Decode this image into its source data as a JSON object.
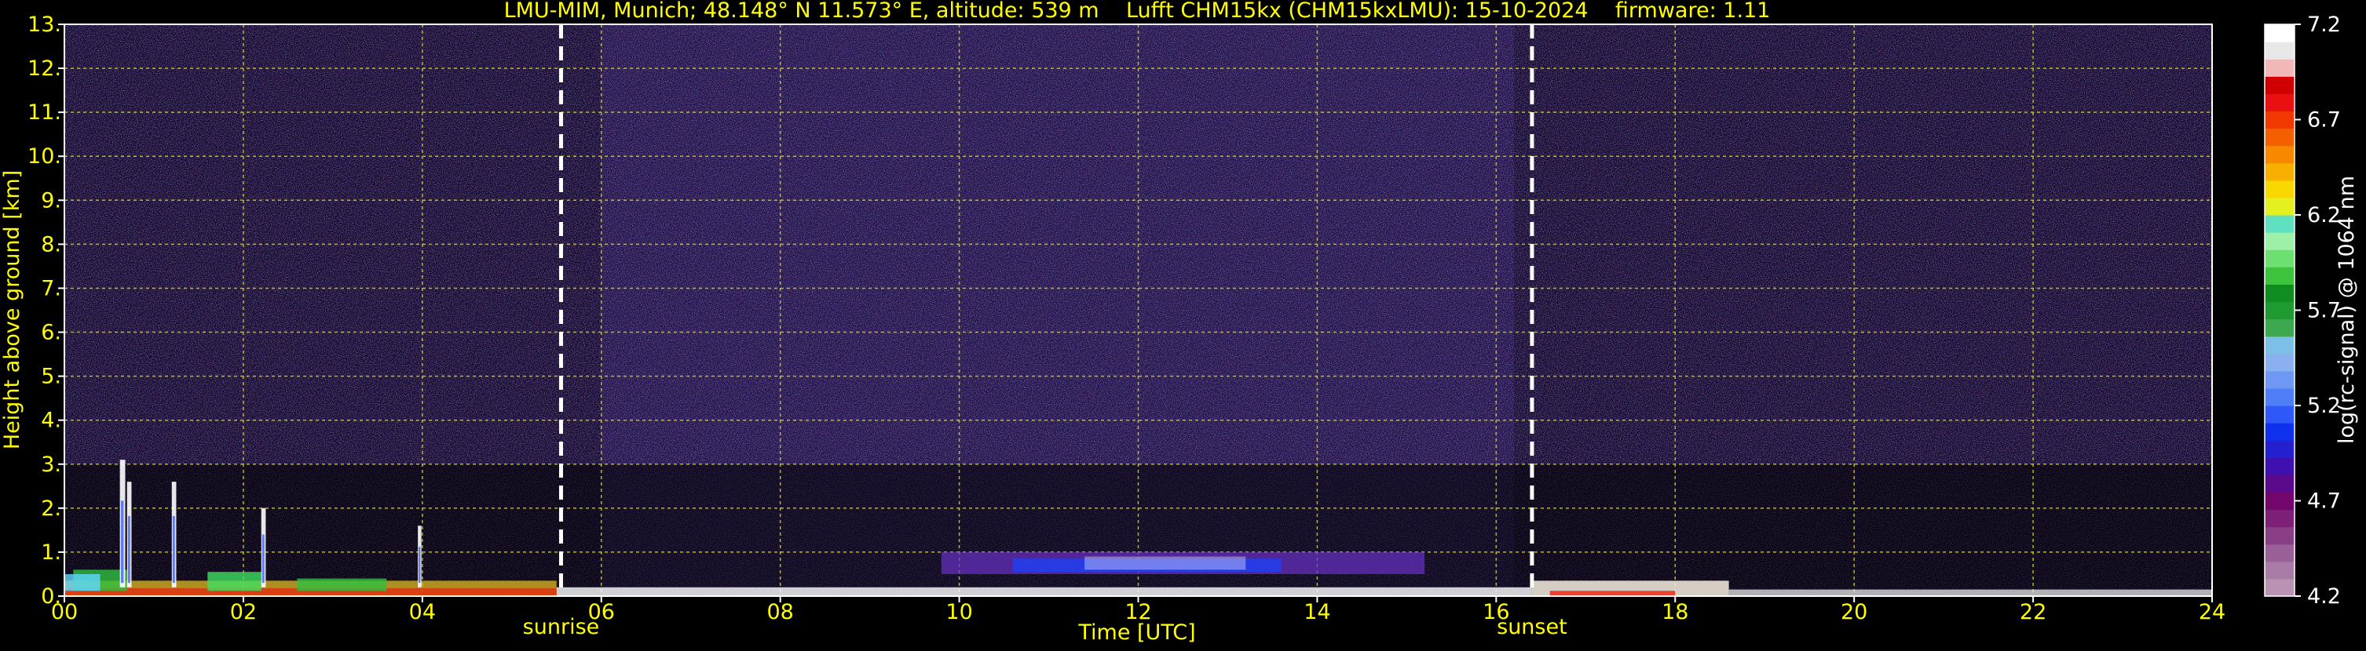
{
  "chart_data": {
    "type": "heatmap",
    "title": "LMU-MIM, Munich; 48.148° N 11.573° E, altitude: 539 m    Lufft CHM15kx (CHM15kxLMU): 15-10-2024    firmware: 1.11",
    "xlabel": "Time [UTC]",
    "ylabel": "Height above ground [km]",
    "xlim": [
      0,
      24
    ],
    "ylim": [
      0,
      13
    ],
    "x_ticks": [
      "00",
      "02",
      "04",
      "06",
      "08",
      "10",
      "12",
      "14",
      "16",
      "18",
      "20",
      "22",
      "24"
    ],
    "y_ticks": [
      "0.",
      "1.",
      "2.",
      "3.",
      "4.",
      "5.",
      "6.",
      "7.",
      "8.",
      "9.",
      "10.",
      "11.",
      "12.",
      "13."
    ],
    "grid": true,
    "colorbar": {
      "label": "log(rc-signal) @ 1064 nm",
      "range": [
        4.2,
        7.2
      ],
      "ticks": [
        "4.2",
        "4.7",
        "5.2",
        "5.7",
        "6.2",
        "6.7",
        "7.2"
      ],
      "colors": [
        "#b894b2",
        "#a87ca6",
        "#9a6098",
        "#8a3e86",
        "#7e1f78",
        "#72066c",
        "#5a0a8a",
        "#3e10b0",
        "#2420d0",
        "#1030f0",
        "#2e58f8",
        "#4f7ef8",
        "#6e98f4",
        "#8ab0f0",
        "#7cc0e8",
        "#3ea850",
        "#1e9a30",
        "#108c20",
        "#3cc43c",
        "#6ce070",
        "#9cf0a8",
        "#60e0c0",
        "#e4f020",
        "#f8d800",
        "#f8b000",
        "#f88800",
        "#f46000",
        "#f03800",
        "#e81010",
        "#d00000",
        "#f0b8b8",
        "#e8e8e8",
        "#ffffff"
      ]
    },
    "events": [
      {
        "label": "sunrise",
        "time": 5.55
      },
      {
        "label": "sunset",
        "time": 16.4
      }
    ]
  }
}
